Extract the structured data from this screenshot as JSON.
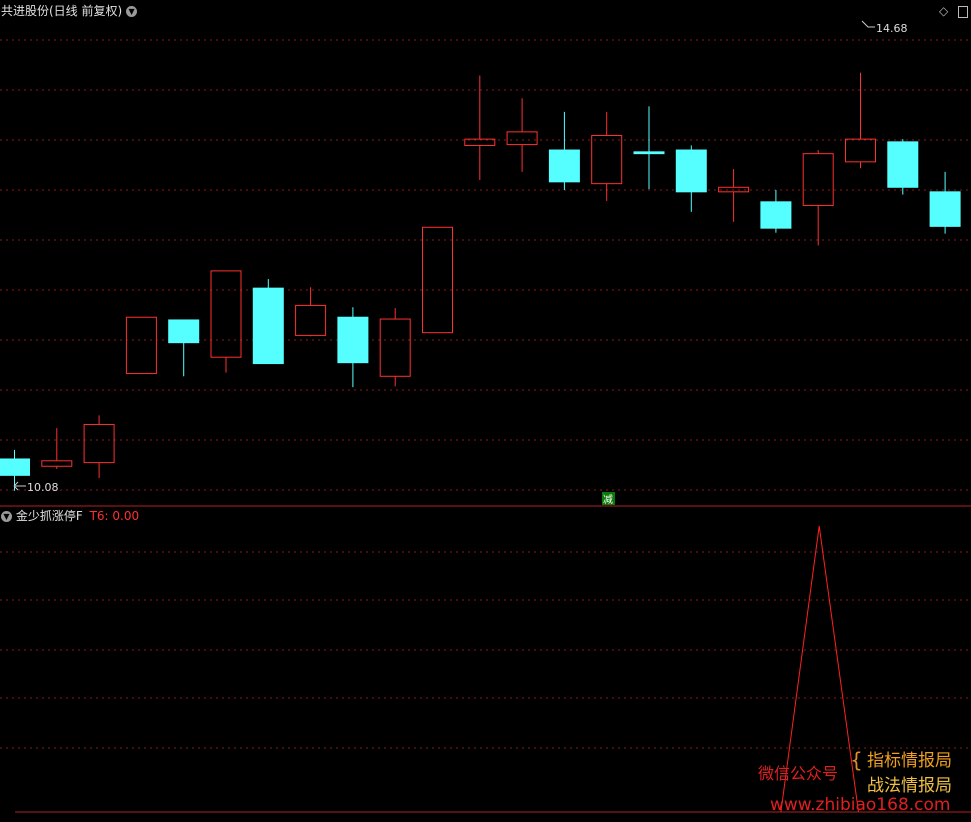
{
  "header": {
    "title": "共进股份(日线 前复权)",
    "dropdown_icon": "chevron-down-icon",
    "tool_icons": [
      "diamond-icon",
      "restore-icon"
    ]
  },
  "annotations": {
    "high_label": "14.68",
    "low_label": "10.08",
    "event_marker": "减"
  },
  "indicator": {
    "name": "金少抓涨停F",
    "value_label": "T6: 0.00",
    "value_color": "#ff3030"
  },
  "watermark": {
    "wechat": "微信公众号",
    "line1": "指标情报局",
    "line2": "战法情报局",
    "url": "www.zhibiao168.com"
  },
  "colors": {
    "up": "#ff3030",
    "down": "#55ffff",
    "grid": "#8b1a1a",
    "indicator_line": "#ff2020"
  },
  "chart_data": [
    {
      "type": "candlestick",
      "title": "共进股份(日线 前复权)",
      "ylim": [
        9.9,
        15.0
      ],
      "max_label": 14.68,
      "min_label": 10.08,
      "candles": [
        {
          "o": 10.43,
          "c": 10.25,
          "h": 10.53,
          "l": 10.08
        },
        {
          "o": 10.35,
          "c": 10.41,
          "h": 10.77,
          "l": 10.32
        },
        {
          "o": 10.39,
          "c": 10.81,
          "h": 10.91,
          "l": 10.22
        },
        {
          "o": 11.37,
          "c": 11.99,
          "h": 11.99,
          "l": 11.37
        },
        {
          "o": 11.96,
          "c": 11.71,
          "h": 11.96,
          "l": 11.34
        },
        {
          "o": 11.55,
          "c": 12.5,
          "h": 12.5,
          "l": 11.38
        },
        {
          "o": 12.31,
          "c": 11.48,
          "h": 12.41,
          "l": 11.48
        },
        {
          "o": 11.79,
          "c": 12.12,
          "h": 12.32,
          "l": 11.78
        },
        {
          "o": 11.99,
          "c": 11.49,
          "h": 12.1,
          "l": 11.22
        },
        {
          "o": 11.34,
          "c": 11.97,
          "h": 12.09,
          "l": 11.23
        },
        {
          "o": 11.82,
          "c": 12.98,
          "h": 12.98,
          "l": 11.82
        },
        {
          "o": 13.88,
          "c": 13.95,
          "h": 14.65,
          "l": 13.5
        },
        {
          "o": 13.89,
          "c": 14.03,
          "h": 14.4,
          "l": 13.59
        },
        {
          "o": 13.83,
          "c": 13.48,
          "h": 14.25,
          "l": 13.39
        },
        {
          "o": 13.46,
          "c": 13.99,
          "h": 14.25,
          "l": 13.27
        },
        {
          "o": 13.81,
          "c": 13.79,
          "h": 14.31,
          "l": 13.4
        },
        {
          "o": 13.83,
          "c": 13.37,
          "h": 13.88,
          "l": 13.15
        },
        {
          "o": 13.37,
          "c": 13.42,
          "h": 13.62,
          "l": 13.04
        },
        {
          "o": 13.26,
          "c": 12.97,
          "h": 13.39,
          "l": 12.92
        },
        {
          "o": 13.22,
          "c": 13.79,
          "h": 13.83,
          "l": 12.78
        },
        {
          "o": 13.7,
          "c": 13.95,
          "h": 14.68,
          "l": 13.63
        },
        {
          "o": 13.92,
          "c": 13.42,
          "h": 13.95,
          "l": 13.34
        },
        {
          "o": 13.37,
          "c": 12.99,
          "h": 13.59,
          "l": 12.91
        }
      ]
    },
    {
      "type": "line",
      "title": "金少抓涨停F",
      "ylim": [
        0,
        1
      ],
      "series": [
        {
          "name": "T6",
          "values": [
            0,
            0,
            0,
            0,
            0,
            0,
            0,
            0,
            0,
            0,
            0,
            0,
            0,
            0,
            0,
            0,
            0,
            0,
            0,
            1,
            0,
            0,
            0
          ]
        }
      ]
    }
  ]
}
